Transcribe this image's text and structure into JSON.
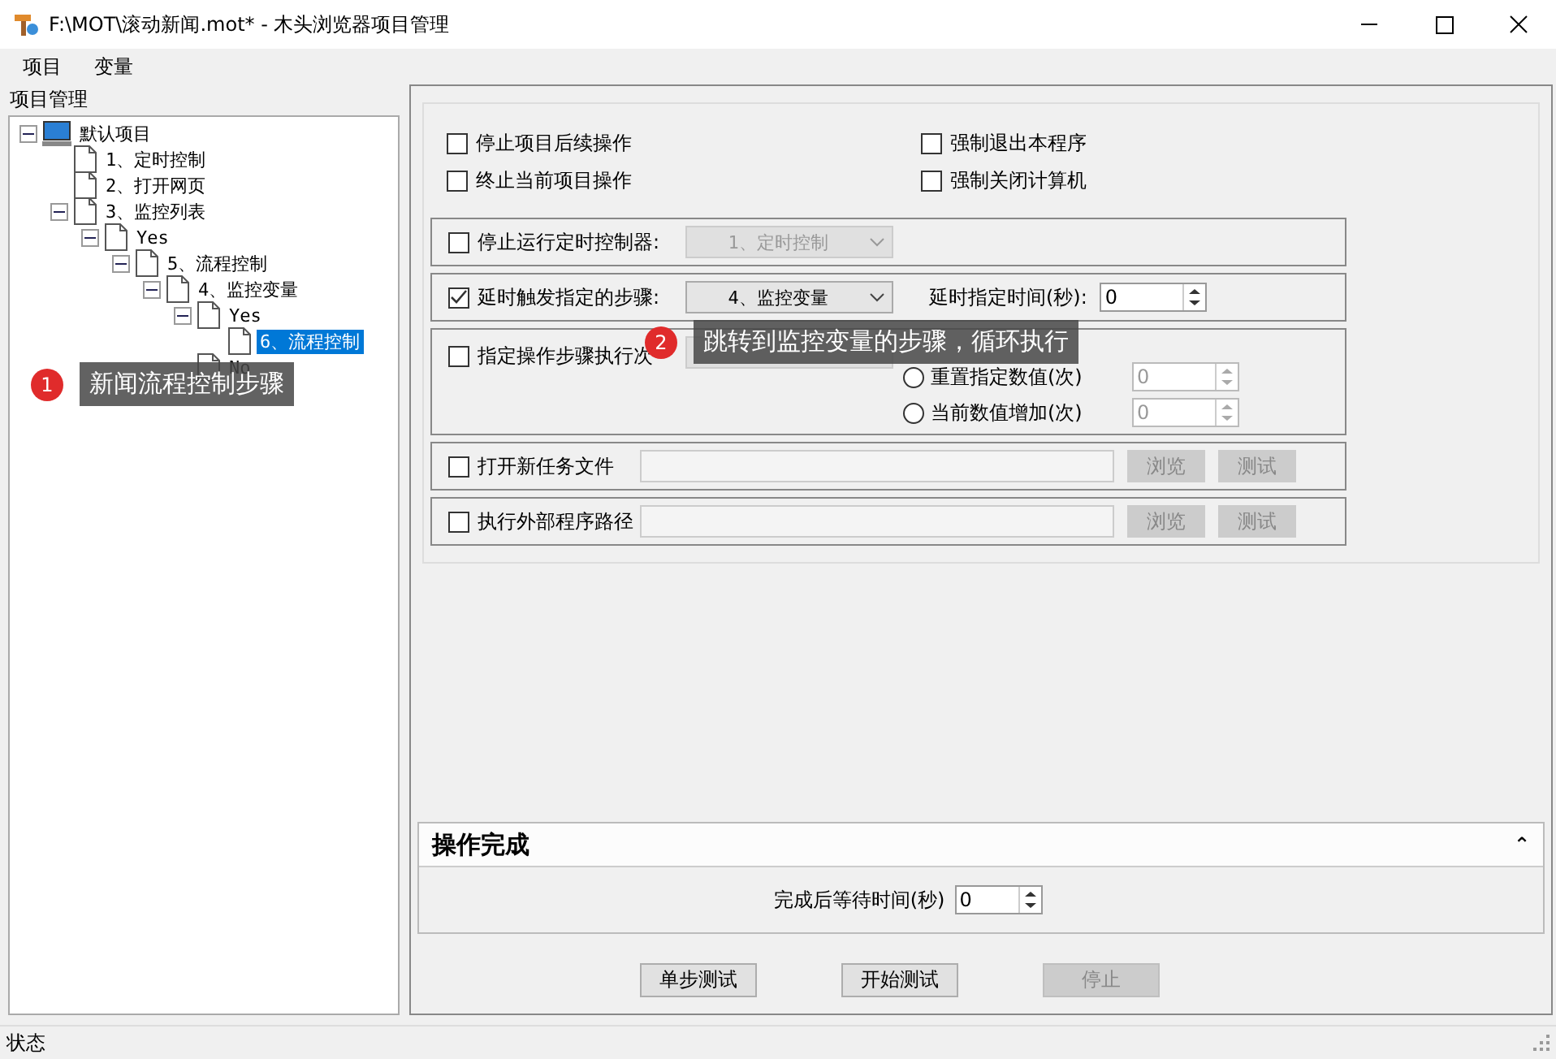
{
  "window": {
    "title": "F:\\MOT\\滚动新闻.mot* - 木头浏览器项目管理"
  },
  "menu": [
    "项目",
    "变量"
  ],
  "sidebar": {
    "title": "项目管理",
    "tree": [
      {
        "label": "默认项目",
        "kind": "project",
        "expanded": true,
        "selected": false,
        "children": [
          {
            "label": "1、定时控制",
            "kind": "step",
            "selected": false
          },
          {
            "label": "2、打开网页",
            "kind": "step",
            "selected": false
          },
          {
            "label": "3、监控列表",
            "kind": "step",
            "expanded": true,
            "selected": false,
            "children": [
              {
                "label": "Yes",
                "kind": "step",
                "expanded": true,
                "selected": false,
                "children": [
                  {
                    "label": "5、流程控制",
                    "kind": "step",
                    "expanded": true,
                    "selected": false,
                    "children": [
                      {
                        "label": "4、监控变量",
                        "kind": "step",
                        "expanded": true,
                        "selected": false,
                        "children": [
                          {
                            "label": "Yes",
                            "kind": "step",
                            "expanded": true,
                            "selected": false,
                            "children": [
                              {
                                "label": "6、流程控制",
                                "kind": "step",
                                "selected": true
                              }
                            ]
                          },
                          {
                            "label": "No",
                            "kind": "step",
                            "selected": false
                          }
                        ]
                      }
                    ]
                  }
                ]
              }
            ]
          }
        ]
      }
    ]
  },
  "options": {
    "top_checks": [
      {
        "label": "停止项目后续操作",
        "checked": false
      },
      {
        "label": "强制退出本程序",
        "checked": false
      },
      {
        "label": "终止当前项目操作",
        "checked": false
      },
      {
        "label": "强制关闭计算机",
        "checked": false
      }
    ],
    "stop_timer": {
      "label": "停止运行定时控制器:",
      "checked": false,
      "combo": "1、定时控制"
    },
    "delay": {
      "label": "延时触发指定的步骤:",
      "checked": true,
      "combo": "4、监控变量",
      "time_label": "延时指定时间(秒):",
      "time_value": "0"
    },
    "repeat": {
      "label": "指定操作步骤执行次",
      "checked": false,
      "radios": [
        {
          "label": "重置指定数值(次)",
          "selected": false,
          "value": "0"
        },
        {
          "label": "当前数值增加(次)",
          "selected": false,
          "value": "0"
        }
      ]
    },
    "paths": [
      {
        "label": "打开新任务文件",
        "checked": false,
        "browse": "浏览",
        "test": "测试"
      },
      {
        "label": "执行外部程序路径",
        "checked": false,
        "browse": "浏览",
        "test": "测试"
      }
    ]
  },
  "finish": {
    "title": "操作完成",
    "collapse": "⌃",
    "wait_label": "完成后等待时间(秒)",
    "wait_value": "0"
  },
  "buttons": [
    {
      "label": "单步测试",
      "disabled": false
    },
    {
      "label": "开始测试",
      "disabled": false
    },
    {
      "label": "停止",
      "disabled": true
    }
  ],
  "callouts": [
    {
      "number": "1",
      "text": "新闻流程控制步骤"
    },
    {
      "number": "2",
      "text": "跳转到监控变量的步骤，循环执行"
    }
  ],
  "status_bar": "状态"
}
